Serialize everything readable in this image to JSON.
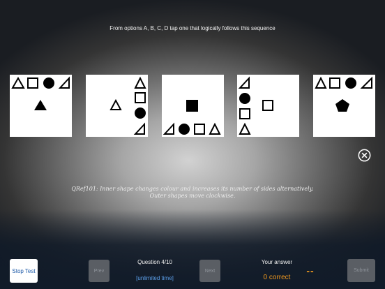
{
  "instruction": "From options A, B, C, D tap one that logically follows this sequence",
  "sequence_panels": [
    {
      "label": "panel 1",
      "outer": [
        "triangle-outline",
        "square-outline",
        "circle-filled",
        "right-triangle-outline"
      ],
      "inner": "triangle-filled"
    },
    {
      "label": "panel 2",
      "outer": [
        "triangle-outline",
        "square-outline",
        "circle-filled",
        "right-triangle-outline"
      ],
      "inner": "triangle-outline"
    },
    {
      "label": "panel 3",
      "outer": [
        "right-triangle-outline",
        "circle-filled",
        "square-outline",
        "triangle-outline"
      ],
      "inner": "square-filled"
    },
    {
      "label": "panel 4",
      "outer": [
        "right-triangle-outline",
        "circle-filled",
        "square-outline",
        "triangle-outline"
      ],
      "inner": "square-outline"
    },
    {
      "label": "panel 5",
      "outer": [
        "triangle-outline",
        "square-outline",
        "circle-filled",
        "right-triangle-outline"
      ],
      "inner": "pentagon-filled"
    }
  ],
  "close_icon": "close-icon",
  "explanation": "QRef101: Inner shape changes colour and increases its number of sides alternatively. Outer shapes move clockwise.",
  "footer": {
    "stop_label": "Stop Test",
    "prev_label": "Prev",
    "next_label": "Next",
    "submit_label": "Submit",
    "question_counter": "Question 4/10",
    "time_label": "[unlimited time]",
    "answer_title": "Your answer",
    "answer_value": "--",
    "correct_count": "0 correct"
  },
  "colors": {
    "answer_accent": "#f39a1f",
    "time_link": "#5b9ee8",
    "stop_text": "#1d5aa8",
    "disabled_button": "#5a5e64"
  }
}
